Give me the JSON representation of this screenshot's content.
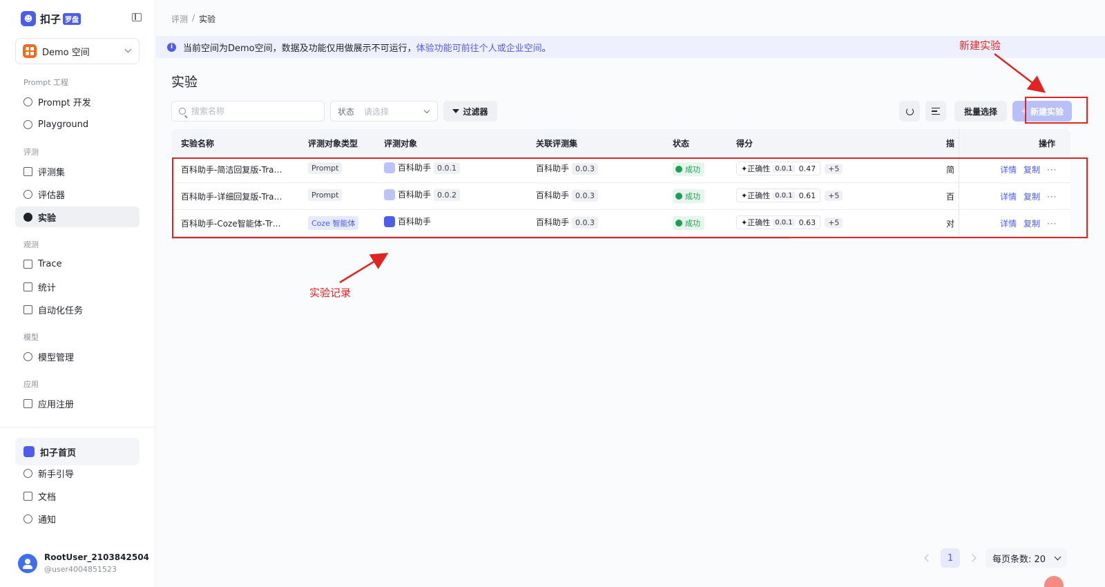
{
  "brand": {
    "name": "扣子",
    "badge": "罗盘"
  },
  "space": {
    "name": "Demo 空间"
  },
  "nav": {
    "groups": [
      "Prompt 工程",
      "评测",
      "观测",
      "模型",
      "应用"
    ],
    "prompt_dev": "Prompt 开发",
    "playground": "Playground",
    "eval_set": "评测集",
    "evaluator": "评估器",
    "experiment": "实验",
    "trace": "Trace",
    "stats": "统计",
    "auto_task": "自动化任务",
    "model_manage": "模型管理",
    "app_register": "应用注册",
    "coze_home": "扣子首页",
    "guide": "新手引导",
    "docs": "文档",
    "notify": "通知"
  },
  "user": {
    "name": "RootUser_2103842504",
    "id": "@user4004851523"
  },
  "breadcrumb": {
    "parent": "评测",
    "sep": "/",
    "current": "实验"
  },
  "notice": {
    "text": "当前空间为Demo空间，数据及功能仅用做展示不可运行，",
    "link": "体验功能可前往个人或企业空间",
    "end": "。"
  },
  "page_title": "实验",
  "search": {
    "placeholder": "搜索名称"
  },
  "status_filter": {
    "label": "状态",
    "placeholder": "请选择"
  },
  "toolbar": {
    "filter": "过滤器",
    "batch": "批量选择",
    "new_plus": "+",
    "new": "新建实验"
  },
  "table": {
    "headers": [
      "实验名称",
      "评测对象类型",
      "评测对象",
      "关联评测集",
      "状态",
      "得分",
      "描述",
      "操作"
    ],
    "desc_header_visible": "描",
    "rows": [
      {
        "name": "百科助手-简洁回复版-Tra…",
        "type": "Prompt",
        "object": "百科助手",
        "object_ver": "0.0.1",
        "dataset": "百科助手",
        "dataset_ver": "0.0.3",
        "status": "成功",
        "metric": "正确性",
        "metric_ver": "0.0.1",
        "score": "0.47",
        "more": "+5",
        "desc": "简",
        "detail": "详情",
        "copy": "复制",
        "ops": "···"
      },
      {
        "name": "百科助手-详细回复版-Tra…",
        "type": "Prompt",
        "object": "百科助手",
        "object_ver": "0.0.2",
        "dataset": "百科助手",
        "dataset_ver": "0.0.3",
        "status": "成功",
        "metric": "正确性",
        "metric_ver": "0.0.1",
        "score": "0.61",
        "more": "+5",
        "desc": "百",
        "detail": "详情",
        "copy": "复制",
        "ops": "···"
      },
      {
        "name": "百科助手-Coze智能体-Tr…",
        "type": "Coze 智能体",
        "object": "百科助手",
        "object_ver": "",
        "dataset": "百科助手",
        "dataset_ver": "0.0.3",
        "status": "成功",
        "metric": "正确性",
        "metric_ver": "0.0.1",
        "score": "0.63",
        "more": "+5",
        "desc": "对",
        "detail": "详情",
        "copy": "复制",
        "ops": "···"
      }
    ]
  },
  "annotations": {
    "new_experiment": "新建实验",
    "records": "实验记录"
  },
  "pagination": {
    "current": "1",
    "page_size_label": "每页条数: 20"
  },
  "colors": {
    "accent": "#4e5de8",
    "annotation": "#e02424",
    "success": "#1f9d55"
  }
}
